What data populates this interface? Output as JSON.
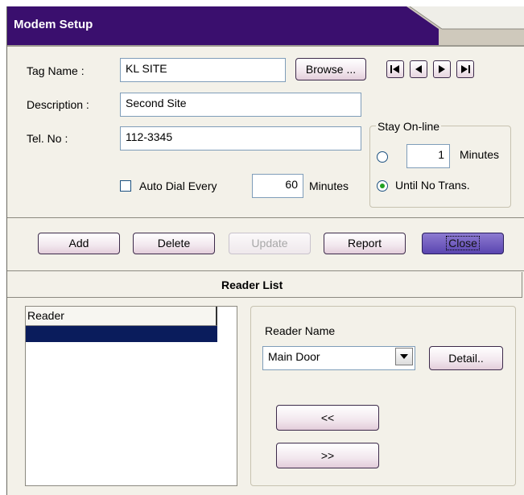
{
  "window": {
    "title": "Modem Setup",
    "accent": "#3a0f6e"
  },
  "form": {
    "tag_name_label": "Tag Name :",
    "tag_name_value": "KL SITE",
    "browse_label": "Browse ...",
    "description_label": "Description :",
    "description_value": "Second Site",
    "tel_label": "Tel. No :",
    "tel_value": "112-3345",
    "auto_dial_label": "Auto Dial Every",
    "auto_dial_checked": false,
    "auto_dial_value": "60",
    "auto_dial_unit": "Minutes",
    "navigation": [
      "first-record-icon",
      "previous-record-icon",
      "next-record-icon",
      "last-record-icon"
    ]
  },
  "stay_online": {
    "title": "Stay On-line",
    "minutes_value": "1",
    "minutes_label": "Minutes",
    "until_label": "Until No Trans.",
    "selected": "until"
  },
  "actions": {
    "add": "Add",
    "delete": "Delete",
    "update": "Update",
    "report": "Report",
    "close": "Close"
  },
  "reader_list": {
    "title": "Reader List",
    "column_header": "Reader",
    "reader_name_label": "Reader Name",
    "reader_name_value": "Main Door",
    "detail_label": "Detail..",
    "move_left": "<<",
    "move_right": ">>"
  }
}
